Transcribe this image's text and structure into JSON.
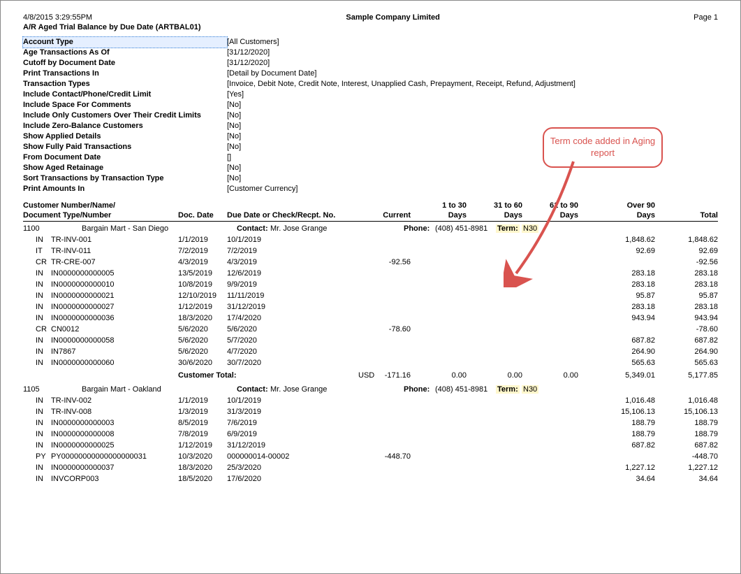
{
  "header": {
    "datetime": "4/8/2015  3:29:55PM",
    "company": "Sample Company Limited",
    "page": "Page 1",
    "report_title": "A/R Aged Trial Balance by Due Date (ARTBAL01)"
  },
  "params": [
    {
      "label": "Account Type",
      "value": "[All Customers]",
      "selected": true
    },
    {
      "label": "Age Transactions As Of",
      "value": "[31/12/2020]"
    },
    {
      "label": "Cutoff by Document Date",
      "value": "[31/12/2020]"
    },
    {
      "label": "Print Transactions In",
      "value": "[Detail by Document Date]"
    },
    {
      "label": "Transaction Types",
      "value": "[Invoice, Debit Note, Credit Note, Interest, Unapplied Cash, Prepayment, Receipt, Refund, Adjustment]"
    },
    {
      "label": "Include Contact/Phone/Credit Limit",
      "value": "[Yes]"
    },
    {
      "label": "Include Space For Comments",
      "value": "[No]"
    },
    {
      "label": "Include Only Customers Over Their Credit Limits",
      "value": "[No]"
    },
    {
      "label": "Include Zero-Balance Customers",
      "value": "[No]"
    },
    {
      "label": "Show Applied Details",
      "value": "[No]"
    },
    {
      "label": "Show Fully Paid Transactions",
      "value": "[No]"
    },
    {
      "label": "From Document Date",
      "value": "[]"
    },
    {
      "label": "Show Aged Retainage",
      "value": "[No]"
    },
    {
      "label": "Sort Transactions by Transaction Type",
      "value": "[No]"
    },
    {
      "label": "Print Amounts In",
      "value": "[Customer Currency]"
    }
  ],
  "col_hdr": {
    "cust_line1": "Customer Number/Name/",
    "cust_line2": "Document Type/Number",
    "doc_date": "Doc. Date",
    "due": "Due Date or Check/Recpt. No.",
    "current": "Current",
    "b1_top": "1   to   30",
    "b1_bot": "Days",
    "b2_top": "31   to   60",
    "b2_bot": "Days",
    "b3_top": "61   to   90",
    "b3_bot": "Days",
    "over_top": "Over   90",
    "over_bot": "Days",
    "total": "Total"
  },
  "customers": [
    {
      "id": "1100",
      "name": "Bargain Mart - San Diego",
      "contact_label": "Contact:",
      "contact": "Mr. Jose Grange",
      "phone_label": "Phone:",
      "phone": "(408) 451-8981",
      "term_label": "Term:",
      "term": "N30",
      "transactions": [
        {
          "type": "IN",
          "num": "TR-INV-001",
          "doc": "1/1/2019",
          "due": "10/1/2019",
          "over": "1,848.62",
          "total": "1,848.62"
        },
        {
          "type": "IT",
          "num": "TR-INV-011",
          "doc": "7/2/2019",
          "due": "7/2/2019",
          "over": "92.69",
          "total": "92.69"
        },
        {
          "type": "CR",
          "num": "TR-CRE-007",
          "doc": "4/3/2019",
          "due": "4/3/2019",
          "current": "-92.56",
          "total": "-92.56"
        },
        {
          "type": "IN",
          "num": "IN0000000000005",
          "doc": "13/5/2019",
          "due": "12/6/2019",
          "over": "283.18",
          "total": "283.18"
        },
        {
          "type": "IN",
          "num": "IN0000000000010",
          "doc": "10/8/2019",
          "due": "9/9/2019",
          "over": "283.18",
          "total": "283.18"
        },
        {
          "type": "IN",
          "num": "IN0000000000021",
          "doc": "12/10/2019",
          "due": "11/11/2019",
          "over": "95.87",
          "total": "95.87"
        },
        {
          "type": "IN",
          "num": "IN0000000000027",
          "doc": "1/12/2019",
          "due": "31/12/2019",
          "over": "283.18",
          "total": "283.18"
        },
        {
          "type": "IN",
          "num": "IN0000000000036",
          "doc": "18/3/2020",
          "due": "17/4/2020",
          "over": "943.94",
          "total": "943.94"
        },
        {
          "type": "CR",
          "num": "CN0012",
          "doc": "5/6/2020",
          "due": "5/6/2020",
          "current": "-78.60",
          "total": "-78.60"
        },
        {
          "type": "IN",
          "num": "IN0000000000058",
          "doc": "5/6/2020",
          "due": "5/7/2020",
          "over": "687.82",
          "total": "687.82"
        },
        {
          "type": "IN",
          "num": "IN7867",
          "doc": "5/6/2020",
          "due": "4/7/2020",
          "over": "264.90",
          "total": "264.90"
        },
        {
          "type": "IN",
          "num": "IN0000000000060",
          "doc": "30/6/2020",
          "due": "30/7/2020",
          "over": "565.63",
          "total": "565.63"
        }
      ],
      "total": {
        "label": "Customer Total:",
        "currency": "USD",
        "current": "-171.16",
        "b1": "0.00",
        "b2": "0.00",
        "b3": "0.00",
        "over": "5,349.01",
        "total": "5,177.85"
      }
    },
    {
      "id": "1105",
      "name": "Bargain Mart - Oakland",
      "contact_label": "Contact:",
      "contact": "Mr. Jose Grange",
      "phone_label": "Phone:",
      "phone": "(408) 451-8981",
      "term_label": "Term:",
      "term": "N30",
      "transactions": [
        {
          "type": "IN",
          "num": "TR-INV-002",
          "doc": "1/1/2019",
          "due": "10/1/2019",
          "over": "1,016.48",
          "total": "1,016.48"
        },
        {
          "type": "IN",
          "num": "TR-INV-008",
          "doc": "1/3/2019",
          "due": "31/3/2019",
          "over": "15,106.13",
          "total": "15,106.13"
        },
        {
          "type": "IN",
          "num": "IN0000000000003",
          "doc": "8/5/2019",
          "due": "7/6/2019",
          "over": "188.79",
          "total": "188.79"
        },
        {
          "type": "IN",
          "num": "IN0000000000008",
          "doc": "7/8/2019",
          "due": "6/9/2019",
          "over": "188.79",
          "total": "188.79"
        },
        {
          "type": "IN",
          "num": "IN0000000000025",
          "doc": "1/12/2019",
          "due": "31/12/2019",
          "over": "687.82",
          "total": "687.82"
        },
        {
          "type": "PY",
          "num": "PY00000000000000000031",
          "doc": "10/3/2020",
          "due": "000000014-00002",
          "current": "-448.70",
          "total": "-448.70"
        },
        {
          "type": "IN",
          "num": "IN0000000000037",
          "doc": "18/3/2020",
          "due": "25/3/2020",
          "over": "1,227.12",
          "total": "1,227.12"
        },
        {
          "type": "IN",
          "num": "INVCORP003",
          "doc": "18/5/2020",
          "due": "17/6/2020",
          "over": "34.64",
          "total": "34.64"
        }
      ]
    }
  ],
  "callout": {
    "text": "Term code added in Aging report"
  }
}
